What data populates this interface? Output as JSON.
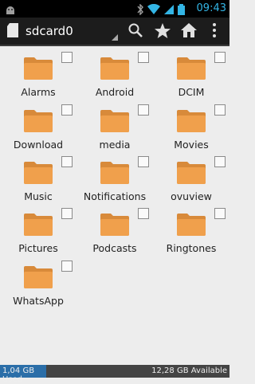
{
  "status": {
    "time": "09:43"
  },
  "actionbar": {
    "title": "sdcard0"
  },
  "folders": [
    {
      "label": "Alarms"
    },
    {
      "label": "Android"
    },
    {
      "label": "DCIM"
    },
    {
      "label": "Download"
    },
    {
      "label": "media"
    },
    {
      "label": "Movies"
    },
    {
      "label": "Music"
    },
    {
      "label": "Notifications"
    },
    {
      "label": "ovuview"
    },
    {
      "label": "Pictures"
    },
    {
      "label": "Podcasts"
    },
    {
      "label": "Ringtones"
    },
    {
      "label": "WhatsApp"
    }
  ],
  "storage": {
    "used": "1,04 GB Used",
    "available": "12,28 GB Available"
  },
  "colors": {
    "folder": "#f0a04c",
    "accent": "#33b5e5",
    "used_bar": "#2b6ea8"
  }
}
